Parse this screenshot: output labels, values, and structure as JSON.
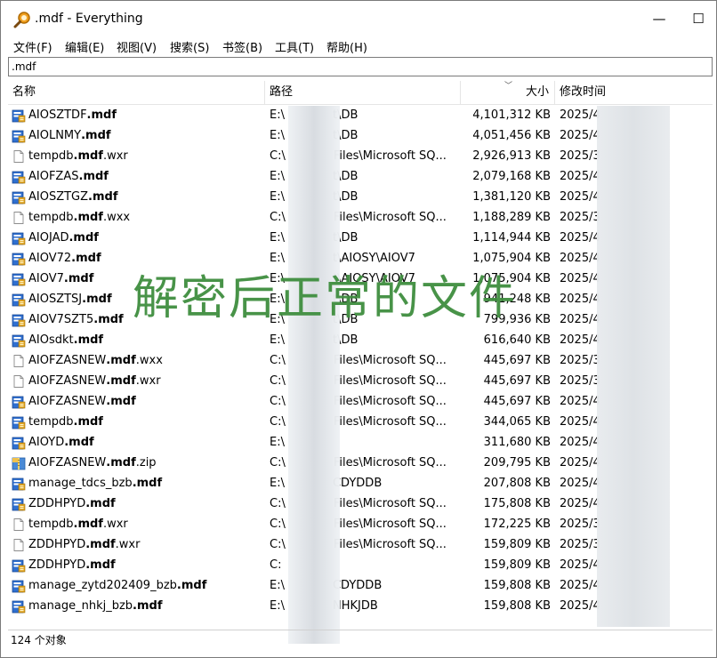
{
  "window": {
    "title": ".mdf - Everything",
    "minimize_label": "—",
    "maximize_label": "☐"
  },
  "menu": [
    {
      "label": "文件(F)"
    },
    {
      "label": "编辑(E)"
    },
    {
      "label": "视图(V)"
    },
    {
      "label": "搜索(S)"
    },
    {
      "label": "书签(B)"
    },
    {
      "label": "工具(T)"
    },
    {
      "label": "帮助(H)"
    }
  ],
  "search": {
    "value": ".mdf"
  },
  "columns": {
    "name": "名称",
    "path": "路径",
    "size": "大小",
    "date": "修改时间"
  },
  "rows": [
    {
      "base": "AIOSZTDF",
      "ext": ".mdf",
      "suffix": "",
      "icon": "db-file-icon",
      "path": "E:\\",
      "path_tail": "t\\DB",
      "size": "4,101,312 KB",
      "date": "2025/4"
    },
    {
      "base": "AIOLNMY",
      "ext": ".mdf",
      "suffix": "",
      "icon": "db-file-icon",
      "path": "E:\\",
      "path_tail": "t\\DB",
      "size": "4,051,456 KB",
      "date": "2025/4"
    },
    {
      "base": "tempdb",
      "ext": ".mdf",
      "suffix": ".wxr",
      "icon": "blank-file-icon",
      "path": "C:\\",
      "path_tail": "Files\\Microsoft SQ...",
      "size": "2,926,913 KB",
      "date": "2025/3"
    },
    {
      "base": "AIOFZAS",
      "ext": ".mdf",
      "suffix": "",
      "icon": "db-file-icon",
      "path": "E:\\",
      "path_tail": "t\\DB",
      "size": "2,079,168 KB",
      "date": "2025/4"
    },
    {
      "base": "AIOSZTGZ",
      "ext": ".mdf",
      "suffix": "",
      "icon": "db-file-icon",
      "path": "E:\\",
      "path_tail": "t\\DB",
      "size": "1,381,120 KB",
      "date": "2025/4"
    },
    {
      "base": "tempdb",
      "ext": ".mdf",
      "suffix": ".wxx",
      "icon": "blank-file-icon",
      "path": "C:\\",
      "path_tail": "Files\\Microsoft SQ...",
      "size": "1,188,289 KB",
      "date": "2025/3"
    },
    {
      "base": "AIOJAD",
      "ext": ".mdf",
      "suffix": "",
      "icon": "db-file-icon",
      "path": "E:\\",
      "path_tail": "t\\DB",
      "size": "1,114,944 KB",
      "date": "2025/4"
    },
    {
      "base": "AIOV72",
      "ext": ".mdf",
      "suffix": "",
      "icon": "db-file-icon",
      "path": "E:\\",
      "path_tail": "t\\AIOSY\\AIOV7",
      "size": "1,075,904 KB",
      "date": "2025/4"
    },
    {
      "base": "AIOV7",
      "ext": ".mdf",
      "suffix": "",
      "icon": "db-file-icon",
      "path": "E:\\",
      "path_tail": "t\\AIOSY\\AIOV7",
      "size": "1,075,904 KB",
      "date": "2025/4"
    },
    {
      "base": "AIOSZTSJ",
      "ext": ".mdf",
      "suffix": "",
      "icon": "db-file-icon",
      "path": "E:\\",
      "path_tail": "t\\DB",
      "size": "941,248 KB",
      "date": "2025/4"
    },
    {
      "base": "AIOV7SZT5",
      "ext": ".mdf",
      "suffix": "",
      "icon": "db-file-icon",
      "path": "E:\\",
      "path_tail": "t\\DB",
      "size": "799,936 KB",
      "date": "2025/4"
    },
    {
      "base": "AIOsdkt",
      "ext": ".mdf",
      "suffix": "",
      "icon": "db-file-icon",
      "path": "E:\\",
      "path_tail": "t\\DB",
      "size": "616,640 KB",
      "date": "2025/4"
    },
    {
      "base": "AIOFZASNEW",
      "ext": ".mdf",
      "suffix": ".wxx",
      "icon": "blank-file-icon",
      "path": "C:\\",
      "path_tail": "Files\\Microsoft SQ...",
      "size": "445,697 KB",
      "date": "2025/3"
    },
    {
      "base": "AIOFZASNEW",
      "ext": ".mdf",
      "suffix": ".wxr",
      "icon": "blank-file-icon",
      "path": "C:\\",
      "path_tail": "Files\\Microsoft SQ...",
      "size": "445,697 KB",
      "date": "2025/3"
    },
    {
      "base": "AIOFZASNEW",
      "ext": ".mdf",
      "suffix": "",
      "icon": "db-file-icon",
      "path": "C:\\",
      "path_tail": "Files\\Microsoft SQ...",
      "size": "445,697 KB",
      "date": "2025/4"
    },
    {
      "base": "tempdb",
      "ext": ".mdf",
      "suffix": "",
      "icon": "db-file-icon",
      "path": "C:\\",
      "path_tail": "Files\\Microsoft SQ...",
      "size": "344,065 KB",
      "date": "2025/4"
    },
    {
      "base": "AIOYD",
      "ext": ".mdf",
      "suffix": "",
      "icon": "db-file-icon",
      "path": "E:\\",
      "path_tail": "",
      "size": "311,680 KB",
      "date": "2025/4"
    },
    {
      "base": "AIOFZASNEW",
      "ext": ".mdf",
      "suffix": ".zip",
      "icon": "zip-file-icon",
      "path": "C:\\",
      "path_tail": "Files\\Microsoft SQ...",
      "size": "209,795 KB",
      "date": "2025/4"
    },
    {
      "base": "manage_tdcs_bzb",
      "ext": ".mdf",
      "suffix": "",
      "icon": "db-file-icon",
      "path": "E:\\",
      "path_tail": "CDYDDB",
      "size": "207,808 KB",
      "date": "2025/4"
    },
    {
      "base": "ZDDHPYD",
      "ext": ".mdf",
      "suffix": "",
      "icon": "db-file-icon",
      "path": "C:\\",
      "path_tail": "Files\\Microsoft SQ...",
      "size": "175,808 KB",
      "date": "2025/4"
    },
    {
      "base": "tempdb",
      "ext": ".mdf",
      "suffix": ".wxr",
      "icon": "blank-file-icon",
      "path": "C:\\",
      "path_tail": "Files\\Microsoft SQ...",
      "size": "172,225 KB",
      "date": "2025/3"
    },
    {
      "base": "ZDDHPYD",
      "ext": ".mdf",
      "suffix": ".wxr",
      "icon": "blank-file-icon",
      "path": "C:\\",
      "path_tail": "Files\\Microsoft SQ...",
      "size": "159,809 KB",
      "date": "2025/3"
    },
    {
      "base": "ZDDHPYD",
      "ext": ".mdf",
      "suffix": "",
      "icon": "db-file-icon",
      "path": "C:",
      "path_tail": "",
      "size": "159,809 KB",
      "date": "2025/4"
    },
    {
      "base": "manage_zytd202409_bzb",
      "ext": ".mdf",
      "suffix": "",
      "icon": "db-file-icon",
      "path": "E:\\",
      "path_tail": "CDYDDB",
      "size": "159,808 KB",
      "date": "2025/4"
    },
    {
      "base": "manage_nhkj_bzb",
      "ext": ".mdf",
      "suffix": "",
      "icon": "db-file-icon",
      "path": "E:\\",
      "path_tail": "NHKJDB",
      "size": "159,808 KB",
      "date": "2025/4"
    }
  ],
  "status": {
    "text": "124 个对象"
  },
  "watermark": {
    "text": "解密后正常的文件"
  },
  "colors": {
    "watermark": "#3f8e3f",
    "db_icon_blue": "#2f6fd0",
    "db_icon_gold": "#e0a526"
  }
}
